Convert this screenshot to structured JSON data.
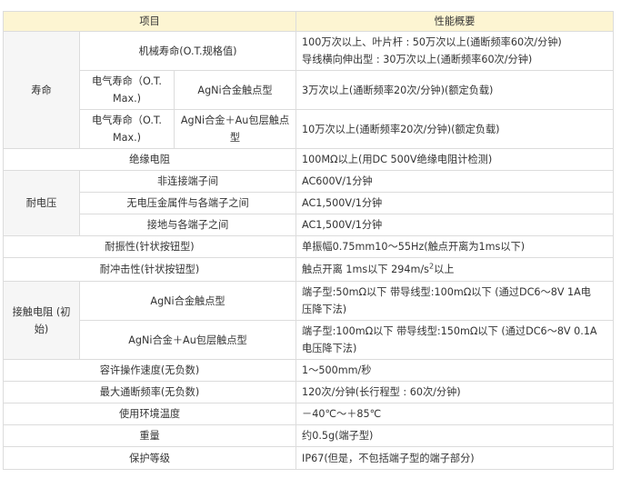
{
  "header": {
    "item": "项目",
    "performance": "性能概要"
  },
  "life": {
    "group": "寿命",
    "mechanical": {
      "label": "机械寿命(O.T.规格值)",
      "line1": "100万次以上、叶片杆 : 50万次以上(通断频率60次/分钟)",
      "line2": "导线横向伸出型 : 30万次以上(通断频率60次/分钟)"
    },
    "electrical_label": "电气寿命（O.T. Max.)",
    "agni": {
      "label": "AgNi合金触点型",
      "value": "3万次以上(通断频率20次/分钟)(额定负载)"
    },
    "agni_au": {
      "label": "AgNi合金＋Au包层触点型",
      "value": "10万次以上(通断频率20次/分钟)(额定负载)"
    }
  },
  "insulation": {
    "label": "绝缘电阻",
    "value": "100MΩ以上(用DC 500V绝缘电阻计检测)"
  },
  "withstand": {
    "group": "耐电压",
    "rows": [
      {
        "label": "非连接端子间",
        "value": "AC600V/1分钟"
      },
      {
        "label": "无电压金属件与各端子之间",
        "value": "AC1,500V/1分钟"
      },
      {
        "label": "接地与各端子之间",
        "value": "AC1,500V/1分钟"
      }
    ]
  },
  "vibration": {
    "label": "耐振性(针状按钮型)",
    "value": "单振幅0.75mm10～55Hz(触点开离为1ms以下)"
  },
  "shock": {
    "label": "耐冲击性(针状按钮型)",
    "value_prefix": "触点开离 1ms以下 294m/s",
    "value_sup": "2",
    "value_suffix": "以上"
  },
  "contact_resistance": {
    "group": "接触电阻 (初始)",
    "agni": {
      "label": "AgNi合金触点型",
      "line1": "端子型:50mΩ以下 带导线型:100mΩ以下 (通过DC6～8V 1A电",
      "line2": "压降下法)"
    },
    "agni_au": {
      "label": "AgNi合金＋Au包层触点型",
      "line1": "端子型:100mΩ以下 带导线型:150mΩ以下 (通过DC6～8V 0.1A",
      "line2": "电压降下法)"
    }
  },
  "speed": {
    "label": "容许操作速度(无负数)",
    "value": "1～500mm/秒"
  },
  "frequency": {
    "label": "最大通断频率(无负数)",
    "value": "120次/分钟(长行程型 : 60次/分钟)"
  },
  "temperature": {
    "label": "使用环境温度",
    "value": "－40℃～＋85℃"
  },
  "weight": {
    "label": "重量",
    "value": "约0.5g(端子型)"
  },
  "protection": {
    "label": "保护等级",
    "value": "IP67(但是，不包括端子型的端子部分)"
  }
}
